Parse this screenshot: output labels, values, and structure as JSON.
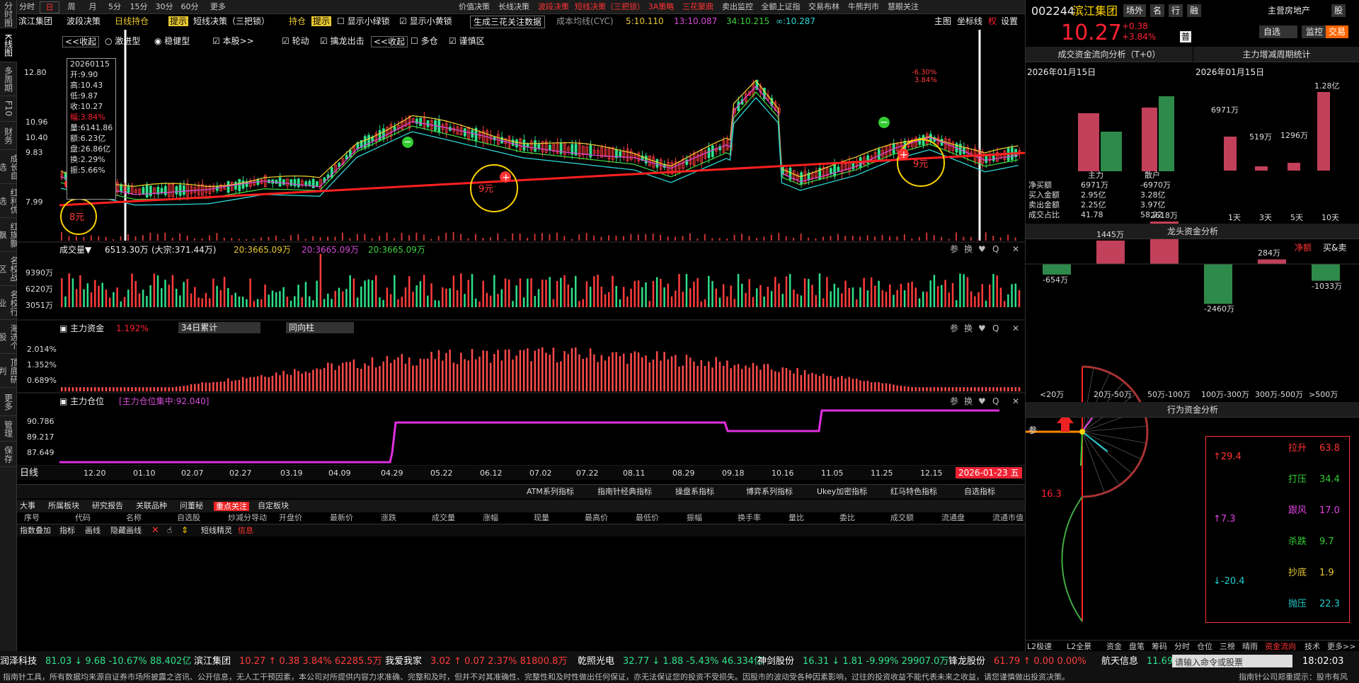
{
  "left_tabs": [
    "分时图",
    "K线图",
    "多周期",
    "F10",
    "财务",
    "成长自选",
    "红利优选",
    "红旗飘飘",
    "名校战区",
    "名校行业",
    "海选个股",
    "顶底研判",
    "更多",
    "管理",
    "保存"
  ],
  "periods": [
    "分时",
    "日",
    "周",
    "月",
    "5分",
    "15分",
    "30分",
    "60分",
    "更多>>"
  ],
  "tools": [
    "价值决策",
    "长线决策",
    "波段决策",
    "短线决策（三把锁）",
    "3A策略",
    "三花聚鼎",
    "卖出监控",
    "全额上证指数",
    "交易布林",
    "牛熊判市",
    "慧眼关注"
  ],
  "header": {
    "stock": "滨江集团",
    "tags": [
      "波段决策",
      "日线持仓",
      "提示",
      "短线决策（三把锁）",
      "持仓",
      "提示"
    ],
    "checks": [
      "显示小绿锁",
      "显示小黄锁"
    ],
    "gen_btn": "生成三花关注数据",
    "ma_label": "成本均线(CYC)",
    "ma5": "5:10.110",
    "ma13": "13:10.087",
    "ma34": "34:10.215",
    "mainf": "∞:10.287",
    "topright": [
      "主图",
      "坐标线",
      "权",
      "设置"
    ]
  },
  "subbar": {
    "items": [
      "<<收起",
      "激进型",
      "稳健型",
      "本股>>",
      "轮动",
      "擒龙出击",
      "<<收起",
      "多仓",
      "谨慎区"
    ]
  },
  "info_box": {
    "date": "20260115",
    "open": "开:9.90",
    "high": "高:10.43",
    "low": "低:9.87",
    "close": "收:10.27",
    "amp": "幅:3.84%",
    "vol": "量:6141.86",
    "amt": "额:6.23亿",
    "pan": "盘:26.86亿",
    "turnover": "换:2.29%",
    "swing": "振:5.66%"
  },
  "yaxis_main": [
    "12.80",
    "10.96",
    "10.40",
    "9.83",
    "7.99"
  ],
  "yaxis_vol": [
    "9390万",
    "6220万",
    "3051万"
  ],
  "yaxis_fund": [
    "2.014%",
    "1.352%",
    "0.689%"
  ],
  "yaxis_pos": [
    "90.786",
    "89.217",
    "87.649"
  ],
  "xaxis": [
    "12.20",
    "01.10",
    "02.07",
    "02.27",
    "03.19",
    "04.09",
    "04.29",
    "05.22",
    "06.12",
    "07.02",
    "07.22",
    "08.11",
    "08.29",
    "09.18",
    "10.16",
    "11.05",
    "11.25",
    "12.15"
  ],
  "circles": [
    "8元",
    "9元",
    "9元"
  ],
  "pct_labels": [
    "-6.30%",
    "3.84%"
  ],
  "vol_hdr": {
    "label": "成交量▼",
    "vol": "6513.30万",
    "dz": "(大宗:371.44万)",
    "m1": "20:3665.09万",
    "m2": "20:3665.09万",
    "m3": "20:3665.09万"
  },
  "fund_hdr": {
    "label": "主力资金",
    "val": "1.192%",
    "sel1": "34日累计",
    "sel2": "同向柱"
  },
  "pos_hdr": {
    "label": "主力仓位",
    "val": "[主力仓位集中:92.040]"
  },
  "panel_icons": [
    "参",
    "换",
    "♥",
    "Q"
  ],
  "x_label": "日线",
  "x_date": "2026-01-23 五",
  "ind_bar": [
    "ATM系列指标",
    "指南针经典指标",
    "操盘系指标",
    "博弈系列指标",
    "Ukey加密指标",
    "红马特色指标",
    "自选指标"
  ],
  "bottom_tabs": [
    "大事",
    "所属板块",
    "研究报告",
    "关联品种",
    "问董秘",
    "重点关注",
    "自定板块"
  ],
  "table_cols": [
    "序号",
    "代码",
    "名称",
    "自选股",
    "炒减分导动",
    "开盘价",
    "最新价",
    "涨跌",
    "成交量",
    "涨幅",
    "现量",
    "最高价",
    "最低价",
    "振幅",
    "换手率",
    "量比",
    "委比",
    "成交额",
    "流通盘",
    "流通市值"
  ],
  "tool_row": [
    "指数叠加",
    "指标",
    "画线",
    "隐藏画线",
    "短线精灵",
    "信息"
  ],
  "right": {
    "code": "002244",
    "name": "滨江集团",
    "btns": [
      "场外",
      "名",
      "行",
      "融"
    ],
    "sector": "主营房地产",
    "btns2": [
      "股"
    ],
    "price": "10.27",
    "chg": "+0.38",
    "pct": "+3.84%",
    "tag": "普",
    "right_btns": [
      "自选",
      "监控",
      "交易"
    ],
    "flow_title": "成交资金流向分析（T+0）",
    "flow_date": "2026年01月15日",
    "flow_cats": [
      "主力",
      "散户"
    ],
    "flow_rows": [
      [
        "净买额",
        "6971万",
        "-6970万"
      ],
      [
        "买入金额",
        "2.95亿",
        "3.28亿"
      ],
      [
        "卖出金额",
        "2.25亿",
        "3.97亿"
      ],
      [
        "成交占比",
        "41.78",
        "58.22"
      ]
    ],
    "cyc_title": "主力增减周期统计",
    "cyc_date": "2026年01月15日",
    "cyc_vals": [
      "6971万",
      "519万",
      "1296万",
      "1.28亿"
    ],
    "cyc_cats": [
      "1天",
      "3天",
      "5天",
      "10天"
    ],
    "dragon_title": "龙头资金分析",
    "dragon_tabs": [
      "净额",
      "买&卖"
    ],
    "dragon_vals": [
      "-654万",
      "1445万",
      "2618万",
      "-2460万",
      "284万",
      "-1033万"
    ],
    "dragon_cats": [
      "<20万",
      "20万-50万",
      "50万-100万",
      "100万-300万",
      "300万-500万",
      ">500万"
    ],
    "behavior_title": "行为资金分析",
    "arrow_val": "16.3",
    "behavior": [
      [
        "↑29.4",
        "拉升",
        "63.8"
      ],
      [
        "",
        "打压",
        "34.4"
      ],
      [
        "↑7.3",
        "跟风",
        "17.0"
      ],
      [
        "",
        "杀跌",
        "9.7"
      ],
      [
        "↓-20.4",
        "抄底",
        "1.9"
      ],
      [
        "",
        "抛压",
        "22.3"
      ]
    ],
    "bottom_tabs": [
      "L2极速",
      "L2全景",
      "资金",
      "盘笔",
      "筹码",
      "分时",
      "仓位",
      "三榜",
      "晴雨",
      "资金流向",
      "技术",
      "更多>>"
    ]
  },
  "ticker": [
    {
      "name": "润泽科技",
      "v": "81.03 ↓ 9.68 -10.67% 88.402亿"
    },
    {
      "name": "滨江集团",
      "v": "10.27 ↑ 0.38 3.84% 62285.5万"
    },
    {
      "name": "我爱我家",
      "v": "3.02 ↑ 0.07 2.37% 81800.8万"
    },
    {
      "name": "乾照光电",
      "v": "32.77 ↓ 1.88 -5.43% 46.334亿"
    },
    {
      "name": "神剑股份",
      "v": "16.31 ↓ 1.81 -9.99% 29907.0万"
    },
    {
      "name": "锋龙股份",
      "v": "61.79 ↑ 0.00 0.00%"
    },
    {
      "name": "航天信息",
      "v": "11.69"
    }
  ],
  "cmd_placeholder": "请输入命令或股票",
  "clock": "18:02:03",
  "disclaimer": "指南针工具，所有数据均来源自证券市场所披露之咨讯、公开信息，无人工干预因素，本公司对所提供内容力求准确、完整和及时，但并不对其准确性、完整性和及时性做出任何保证，亦无法保证您的投资不受损失。因股市的波动受各种因素影响，过往的投资收益不能代表未来之收益，请您谨慎做出投资决策。",
  "brand": "指南针公司郑重提示：股市有风",
  "colors": {
    "up": "#ff3b3b",
    "down": "#2ee08a",
    "accent": "#e8c832"
  }
}
